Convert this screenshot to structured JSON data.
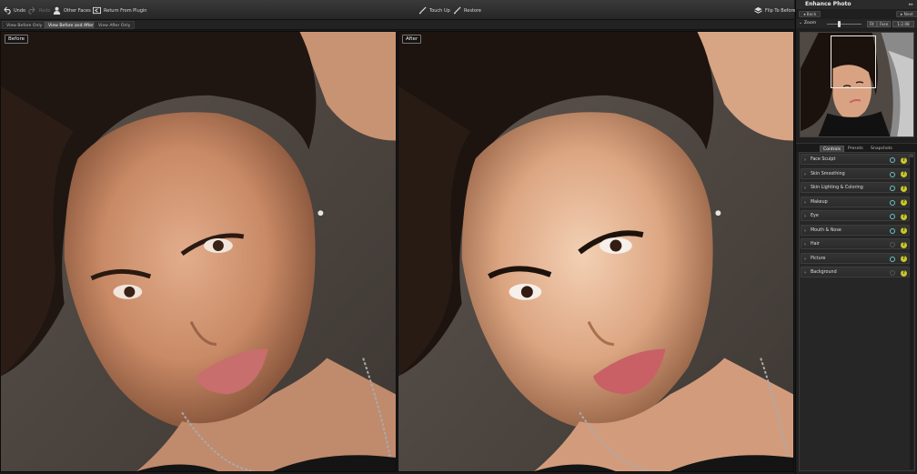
{
  "toolbar": {
    "undo": "Undo",
    "redo": "Redo",
    "other_faces": "Other Faces",
    "return": "Return From Plugin",
    "touch_up": "Touch Up",
    "restore": "Restore",
    "flip": "Flip To Before"
  },
  "view_tabs": [
    "View Before Only",
    "View Before and After",
    "View After Only"
  ],
  "panels": {
    "before": "Before",
    "after": "After"
  },
  "sidebar": {
    "title": "Enhance Photo",
    "back": "Back",
    "next": "Next",
    "zoom": "Zoom",
    "fit": "Fit",
    "face": "Face",
    "ratio": "1:2.08",
    "tabs": [
      "Controls",
      "Presets",
      "Snapshots"
    ],
    "controls": [
      {
        "label": "Face Sculpt",
        "active": true
      },
      {
        "label": "Skin Smoothing",
        "active": true
      },
      {
        "label": "Skin Lighting & Coloring",
        "active": true
      },
      {
        "label": "Makeup",
        "active": true
      },
      {
        "label": "Eye",
        "active": true
      },
      {
        "label": "Mouth & Nose",
        "active": true
      },
      {
        "label": "Hair",
        "active": false
      },
      {
        "label": "Picture",
        "active": true
      },
      {
        "label": "Background",
        "active": false
      }
    ]
  },
  "colors": {
    "accent": "#6fc3c8",
    "help": "#c9c72a"
  }
}
